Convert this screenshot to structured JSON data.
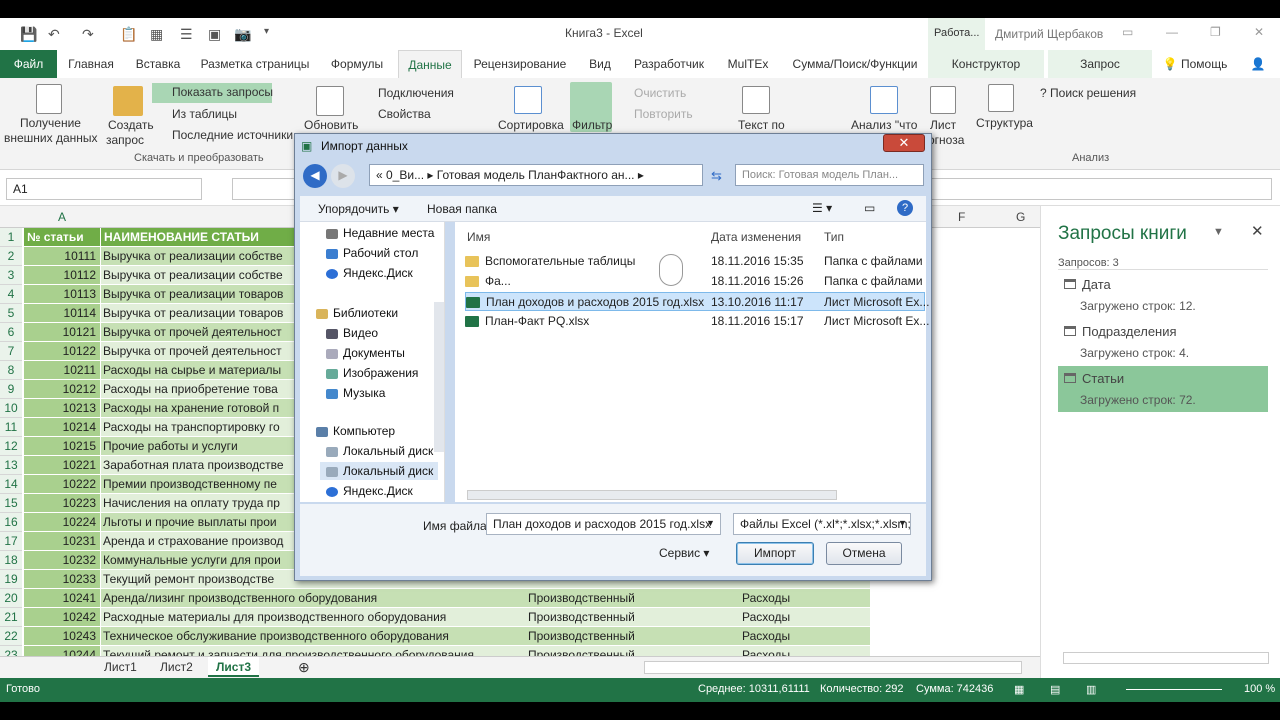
{
  "window": {
    "doc_title": "Книга3 - Excel",
    "context_group": "Работа...",
    "user": "Дмитрий Щербаков"
  },
  "tabs": [
    {
      "label": "Файл"
    },
    {
      "label": "Главная"
    },
    {
      "label": "Вставка"
    },
    {
      "label": "Разметка страницы"
    },
    {
      "label": "Формулы"
    },
    {
      "label": "Данные"
    },
    {
      "label": "Рецензирование"
    },
    {
      "label": "Вид"
    },
    {
      "label": "Разработчик"
    },
    {
      "label": "MulTEx"
    },
    {
      "label": "Сумма/Поиск/Функции"
    },
    {
      "label": "Конструктор"
    },
    {
      "label": "Запрос"
    },
    {
      "label": "Помощь"
    }
  ],
  "ribbon": {
    "get_external_line1": "Получение",
    "get_external_line2": "внешних данных",
    "create_query_line1": "Создать",
    "create_query_line2": "запрос",
    "show_queries": "Показать запросы",
    "from_table": "Из таблицы",
    "recent_sources": "Последние источники",
    "group_get_transform": "Скачать и преобразовать",
    "refresh_all": "Обновить",
    "connections": "Подключения",
    "properties": "Свойства",
    "sort": "Сортировка",
    "filter": "Фильтр",
    "clear": "Очистить",
    "reapply": "Повторить",
    "text_to": "Текст по",
    "what_if_line1": "Анализ \"что",
    "sheet_line1": "Лист",
    "sheet_line2": "огноза",
    "structure": "Структура",
    "solver": "Поиск решения",
    "group_analysis": "Анализ"
  },
  "formula_bar": {
    "name_box": "A1"
  },
  "grid": {
    "col_a": "A",
    "col_f": "F",
    "col_g": "G",
    "header_a": "№ статьи",
    "header_b": "НАИМЕНОВАНИЕ СТАТЬИ",
    "rows": [
      {
        "n": "2",
        "a": "10111",
        "b": "Выручка от реализации собстве",
        "c": "",
        "d": ""
      },
      {
        "n": "3",
        "a": "10112",
        "b": "Выручка от реализации собстве",
        "c": "",
        "d": ""
      },
      {
        "n": "4",
        "a": "10113",
        "b": "Выручка от реализации товаров",
        "c": "",
        "d": ""
      },
      {
        "n": "5",
        "a": "10114",
        "b": "Выручка от реализации товаров",
        "c": "",
        "d": ""
      },
      {
        "n": "6",
        "a": "10121",
        "b": "Выручка от прочей деятельност",
        "c": "",
        "d": ""
      },
      {
        "n": "7",
        "a": "10122",
        "b": "Выручка от прочей деятельност",
        "c": "",
        "d": ""
      },
      {
        "n": "8",
        "a": "10211",
        "b": "Расходы на сырье и материалы",
        "c": "",
        "d": ""
      },
      {
        "n": "9",
        "a": "10212",
        "b": "Расходы на приобретение това",
        "c": "",
        "d": ""
      },
      {
        "n": "10",
        "a": "10213",
        "b": "Расходы на хранение готовой п",
        "c": "",
        "d": ""
      },
      {
        "n": "11",
        "a": "10214",
        "b": "Расходы на транспортировку го",
        "c": "",
        "d": ""
      },
      {
        "n": "12",
        "a": "10215",
        "b": "Прочие работы и услуги",
        "c": "",
        "d": ""
      },
      {
        "n": "13",
        "a": "10221",
        "b": "Заработная плата производстве",
        "c": "",
        "d": ""
      },
      {
        "n": "14",
        "a": "10222",
        "b": "Премии производственному пе",
        "c": "",
        "d": ""
      },
      {
        "n": "15",
        "a": "10223",
        "b": "Начисления на оплату труда пр",
        "c": "",
        "d": ""
      },
      {
        "n": "16",
        "a": "10224",
        "b": "Льготы и прочие выплаты прои",
        "c": "",
        "d": ""
      },
      {
        "n": "17",
        "a": "10231",
        "b": "Аренда и страхование производ",
        "c": "",
        "d": ""
      },
      {
        "n": "18",
        "a": "10232",
        "b": "Коммунальные услуги для прои",
        "c": "",
        "d": ""
      },
      {
        "n": "19",
        "a": "10233",
        "b": "Текущий ремонт производстве",
        "c": "",
        "d": ""
      },
      {
        "n": "20",
        "a": "10241",
        "b": "Аренда/лизинг производственного оборудования",
        "c": "Производственный",
        "d": "Расходы"
      },
      {
        "n": "21",
        "a": "10242",
        "b": "Расходные материалы для производственного оборудования",
        "c": "Производственный",
        "d": "Расходы"
      },
      {
        "n": "22",
        "a": "10243",
        "b": "Техническое обслуживание производственного оборудования",
        "c": "Производственный",
        "d": "Расходы"
      },
      {
        "n": "23",
        "a": "10244",
        "b": "Текущий ремонт и запчасти для производственного оборудования",
        "c": "Производственный",
        "d": "Расходы"
      }
    ]
  },
  "sheets": [
    {
      "label": "Лист1"
    },
    {
      "label": "Лист2"
    },
    {
      "label": "Лист3"
    }
  ],
  "status": {
    "ready": "Готово",
    "average": "Среднее: 10311,61111",
    "count": "Количество: 292",
    "sum": "Сумма: 742436",
    "zoom": "100 %"
  },
  "queries_pane": {
    "title": "Запросы книги",
    "count": "Запросов: 3",
    "items": [
      {
        "name": "Дата",
        "status": "Загружено строк: 12."
      },
      {
        "name": "Подразделения",
        "status": "Загружено строк: 4."
      },
      {
        "name": "Статьи",
        "status": "Загружено строк: 72."
      }
    ]
  },
  "dialog": {
    "title": "Импорт данных",
    "address": "«  0_Ви...  ▸  Готовая модель ПланФактного ан...  ▸",
    "search_placeholder": "Поиск: Готовая модель План...",
    "organize": "Упорядочить",
    "new_folder": "Новая папка",
    "nav": [
      {
        "label": "Недавние места"
      },
      {
        "label": "Рабочий стол"
      },
      {
        "label": "Яндекс.Диск"
      },
      {
        "label": "Библиотеки"
      },
      {
        "label": "Видео"
      },
      {
        "label": "Документы"
      },
      {
        "label": "Изображения"
      },
      {
        "label": "Музыка"
      },
      {
        "label": "Компьютер"
      },
      {
        "label": "Локальный диск"
      },
      {
        "label": "Локальный диск"
      },
      {
        "label": "Яндекс.Диск"
      }
    ],
    "columns": {
      "name": "Имя",
      "date": "Дата изменения",
      "type": "Тип"
    },
    "files": [
      {
        "name": "Вспомогательные таблицы",
        "date": "18.11.2016 15:35",
        "type": "Папка с файлами"
      },
      {
        "name": "Фа...",
        "date": "18.11.2016 15:26",
        "type": "Папка с файлами"
      },
      {
        "name": "План доходов и расходов 2015 год.xlsx",
        "date": "13.10.2016 11:17",
        "type": "Лист Microsoft Ex..."
      },
      {
        "name": "План-Факт PQ.xlsx",
        "date": "18.11.2016 15:17",
        "type": "Лист Microsoft Ex..."
      }
    ],
    "filename_label": "Имя файла:",
    "filename_value": "План доходов и расходов 2015 год.xlsx",
    "filter_value": "Файлы Excel (*.xl*;*.xlsx;*.xlsm;*",
    "service": "Сервис",
    "import": "Импорт",
    "cancel": "Отмена"
  }
}
